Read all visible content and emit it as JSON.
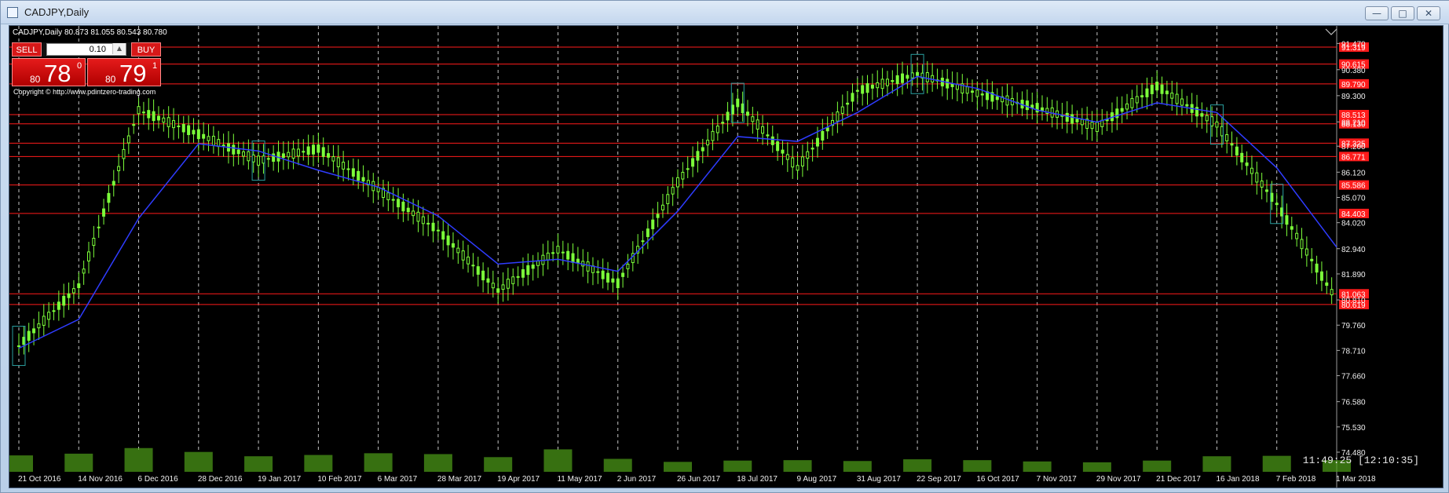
{
  "window": {
    "title": "CADJPY,Daily",
    "minimize": "—",
    "maximize": "□",
    "close": "✕"
  },
  "chart": {
    "header_symbol": "CADJPY,Daily",
    "ohlc": "80.873 81.055 80.543 80.780",
    "copyright": "Copyright © http://www.pdintzero-trading.com",
    "clock": "11:49:25 [12:10:35]"
  },
  "trade_panel": {
    "sell_label": "SELL",
    "buy_label": "BUY",
    "lot": "0.10",
    "sell_prefix": "80",
    "sell_big": "78",
    "sell_sup": "0",
    "buy_prefix": "80",
    "buy_big": "79",
    "buy_sup": "1"
  },
  "chart_data": {
    "type": "candlestick",
    "title": "",
    "x_tick_labels": [
      "21 Oct 2016",
      "14 Nov 2016",
      "6 Dec 2016",
      "28 Dec 2016",
      "19 Jan 2017",
      "10 Feb 2017",
      "6 Mar 2017",
      "28 Mar 2017",
      "19 Apr 2017",
      "11 May 2017",
      "2 Jun 2017",
      "26 Jun 2017",
      "18 Jul 2017",
      "9 Aug 2017",
      "31 Aug 2017",
      "22 Sep 2017",
      "16 Oct 2017",
      "7 Nov 2017",
      "29 Nov 2017",
      "21 Dec 2017",
      "16 Jan 2018",
      "7 Feb 2018",
      "1 Mar 2018"
    ],
    "y_tick_labels": [
      "91.470",
      "90.380",
      "89.300",
      "88.210",
      "87.200",
      "86.120",
      "85.070",
      "84.020",
      "82.940",
      "81.890",
      "80.810",
      "79.760",
      "78.710",
      "77.660",
      "76.580",
      "75.530",
      "74.480"
    ],
    "levels": [
      {
        "label": "91.319",
        "value": 91.319
      },
      {
        "label": "90.615",
        "value": 90.615
      },
      {
        "label": "89.790",
        "value": 89.79
      },
      {
        "label": "88.513",
        "value": 88.513
      },
      {
        "label": "88.130",
        "value": 88.13
      },
      {
        "label": "87.325",
        "value": 87.325
      },
      {
        "label": "86.771",
        "value": 86.771
      },
      {
        "label": "85.586",
        "value": 85.586
      },
      {
        "label": "84.403",
        "value": 84.403
      },
      {
        "label": "81.063",
        "value": 81.063
      },
      {
        "label": "80.619",
        "value": 80.619
      }
    ],
    "y_range": [
      74.48,
      92.2
    ],
    "price_series": [
      {
        "x": "21 Oct 2016",
        "y": 78.9
      },
      {
        "x": "14 Nov 2016",
        "y": 81.4
      },
      {
        "x": "6 Dec 2016",
        "y": 88.7
      },
      {
        "x": "28 Dec 2016",
        "y": 87.7
      },
      {
        "x": "19 Jan 2017",
        "y": 86.6
      },
      {
        "x": "10 Feb 2017",
        "y": 87.1
      },
      {
        "x": "6 Mar 2017",
        "y": 85.4
      },
      {
        "x": "28 Mar 2017",
        "y": 83.7
      },
      {
        "x": "19 Apr 2017",
        "y": 81.2
      },
      {
        "x": "11 May 2017",
        "y": 82.9
      },
      {
        "x": "2 Jun 2017",
        "y": 81.5
      },
      {
        "x": "26 Jun 2017",
        "y": 85.7
      },
      {
        "x": "18 Jul 2017",
        "y": 89.0
      },
      {
        "x": "9 Aug 2017",
        "y": 86.3
      },
      {
        "x": "31 Aug 2017",
        "y": 89.5
      },
      {
        "x": "22 Sep 2017",
        "y": 90.2
      },
      {
        "x": "16 Oct 2017",
        "y": 89.4
      },
      {
        "x": "7 Nov 2017",
        "y": 88.8
      },
      {
        "x": "29 Nov 2017",
        "y": 88.0
      },
      {
        "x": "21 Dec 2017",
        "y": 89.7
      },
      {
        "x": "16 Jan 2018",
        "y": 88.1
      },
      {
        "x": "7 Feb 2018",
        "y": 84.8
      },
      {
        "x": "1 Mar 2018",
        "y": 80.8
      }
    ],
    "moving_average": [
      {
        "x": "21 Oct 2016",
        "y": 78.8
      },
      {
        "x": "14 Nov 2016",
        "y": 80.0
      },
      {
        "x": "6 Dec 2016",
        "y": 84.2
      },
      {
        "x": "28 Dec 2016",
        "y": 87.3
      },
      {
        "x": "19 Jan 2017",
        "y": 87.0
      },
      {
        "x": "10 Feb 2017",
        "y": 86.2
      },
      {
        "x": "6 Mar 2017",
        "y": 85.5
      },
      {
        "x": "28 Mar 2017",
        "y": 84.3
      },
      {
        "x": "19 Apr 2017",
        "y": 82.3
      },
      {
        "x": "11 May 2017",
        "y": 82.5
      },
      {
        "x": "2 Jun 2017",
        "y": 82.0
      },
      {
        "x": "26 Jun 2017",
        "y": 84.5
      },
      {
        "x": "18 Jul 2017",
        "y": 87.6
      },
      {
        "x": "9 Aug 2017",
        "y": 87.4
      },
      {
        "x": "31 Aug 2017",
        "y": 88.6
      },
      {
        "x": "22 Sep 2017",
        "y": 90.1
      },
      {
        "x": "16 Oct 2017",
        "y": 89.6
      },
      {
        "x": "7 Nov 2017",
        "y": 88.7
      },
      {
        "x": "29 Nov 2017",
        "y": 88.2
      },
      {
        "x": "21 Dec 2017",
        "y": 89.0
      },
      {
        "x": "16 Jan 2018",
        "y": 88.6
      },
      {
        "x": "7 Feb 2018",
        "y": 86.3
      },
      {
        "x": "1 Mar 2018",
        "y": 83.0
      }
    ],
    "volume_relative": [
      0.38,
      0.42,
      0.55,
      0.46,
      0.36,
      0.39,
      0.43,
      0.41,
      0.34,
      0.52,
      0.3,
      0.23,
      0.26,
      0.27,
      0.25,
      0.29,
      0.27,
      0.24,
      0.22,
      0.26,
      0.36,
      0.37,
      0.27
    ],
    "grid": true,
    "colors": {
      "background": "#000000",
      "candles": "#7cff3a",
      "moving_average": "#2f3cff",
      "levels": "#ff1b1b",
      "grid": "#d9d9d9",
      "rectangles": "#2aa0a0"
    }
  }
}
